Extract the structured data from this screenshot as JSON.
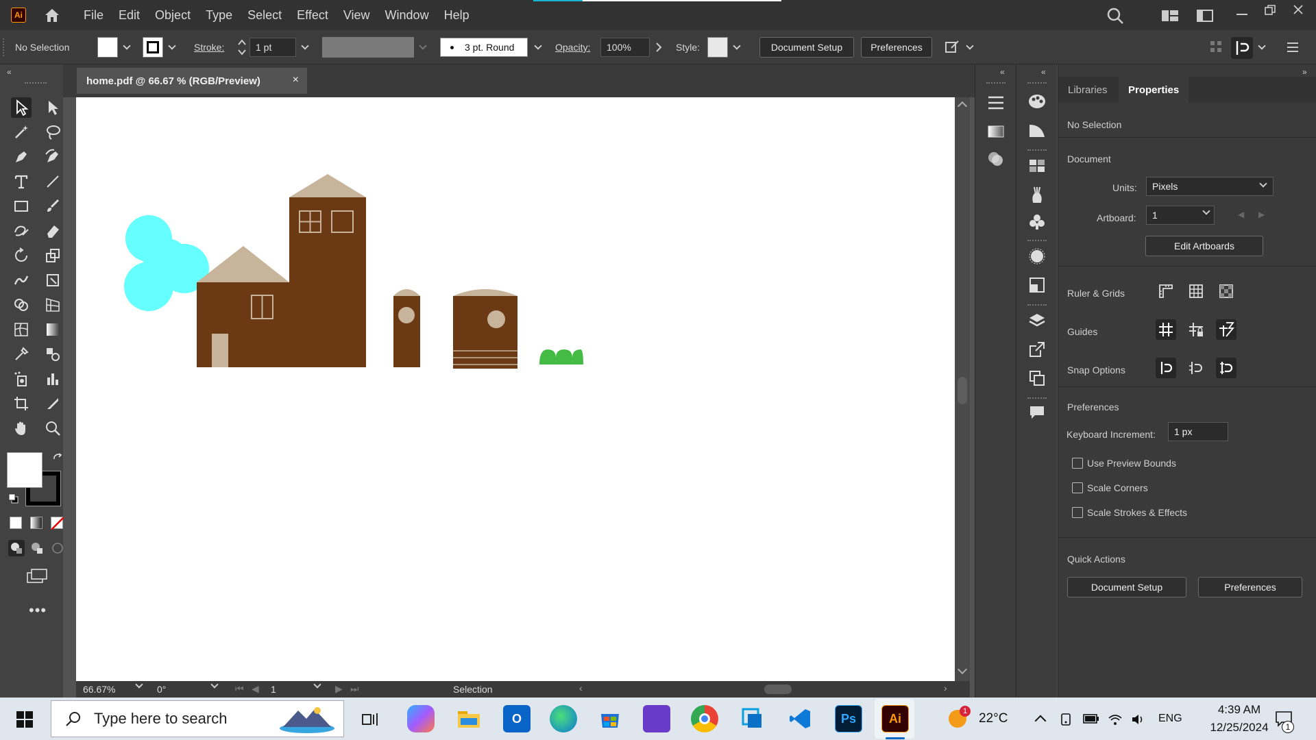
{
  "menubar": {
    "app_logo": "Ai",
    "menus": [
      "File",
      "Edit",
      "Object",
      "Type",
      "Select",
      "Effect",
      "View",
      "Window",
      "Help"
    ]
  },
  "controlbar": {
    "selection": "No Selection",
    "stroke_label": "Stroke:",
    "stroke_value": "1 pt",
    "brush_value": "3 pt. Round",
    "opacity_label": "Opacity:",
    "opacity_value": "100%",
    "style_label": "Style:",
    "document_setup": "Document Setup",
    "preferences": "Preferences"
  },
  "document": {
    "tab_title": "home.pdf @ 66.67 % (RGB/Preview)",
    "close_glyph": "×"
  },
  "statusbar": {
    "zoom": "66.67%",
    "rotation": "0°",
    "artboard_num": "1",
    "tool": "Selection"
  },
  "properties": {
    "tabs": [
      "Libraries",
      "Properties"
    ],
    "selection": "No Selection",
    "document_heading": "Document",
    "units_label": "Units:",
    "units_value": "Pixels",
    "artboard_label": "Artboard:",
    "artboard_value": "1",
    "edit_artboards": "Edit Artboards",
    "ruler_grids": "Ruler & Grids",
    "guides": "Guides",
    "snap_options": "Snap Options",
    "preferences_heading": "Preferences",
    "keyboard_increment_label": "Keyboard Increment:",
    "keyboard_increment_value": "1 px",
    "checkboxes": [
      "Use Preview Bounds",
      "Scale Corners",
      "Scale Strokes & Effects"
    ],
    "quick_actions": "Quick Actions",
    "qa_document_setup": "Document Setup",
    "qa_preferences": "Preferences"
  },
  "taskbar": {
    "search_placeholder": "Type here to search",
    "weather": "22°C",
    "weather_badge": "1",
    "language": "ENG",
    "time": "4:39 AM",
    "date": "12/25/2024",
    "notifications": "1"
  },
  "colors": {
    "house_brown": "#6b3a15",
    "roof_tan": "#c8b49a",
    "cloud_cyan": "#66ffff",
    "bush_green": "#44bb44",
    "accent": "#1ab5d4"
  }
}
